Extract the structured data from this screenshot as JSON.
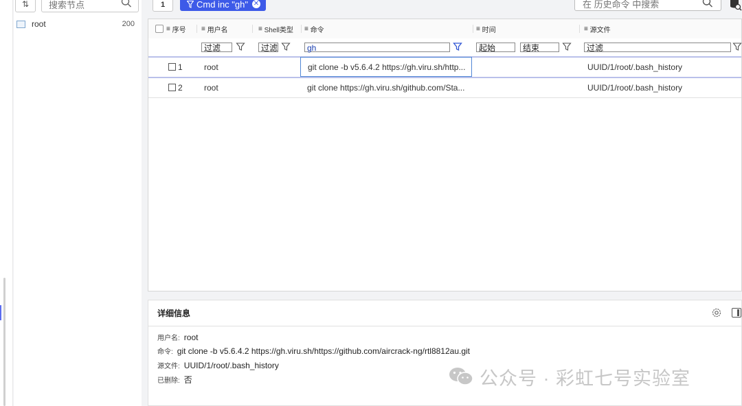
{
  "sidebar": {
    "sort_label": "⇅",
    "search_placeholder": "搜索节点",
    "tree": [
      {
        "label": "root",
        "count": "200"
      }
    ]
  },
  "toolbar": {
    "page_label": "1",
    "filter_chip": "Cmd inc \"gh\"",
    "history_search_placeholder": "在 历史命令 中搜索"
  },
  "table": {
    "headers": {
      "index": "序号",
      "username": "用户名",
      "shell_type": "Shell类型",
      "command": "命令",
      "time": "时间",
      "source_file": "源文件"
    },
    "filters": {
      "username": "过滤",
      "shell_type": "过滤",
      "command": "gh",
      "time_start": "起始",
      "time_end": "结束",
      "source_file": "过滤"
    },
    "rows": [
      {
        "index": "1",
        "username": "root",
        "shell_type": "",
        "command": "git clone -b v5.6.4.2 https://gh.viru.sh/http...",
        "time": "",
        "source_file": "UUID/1/root/.bash_history"
      },
      {
        "index": "2",
        "username": "root",
        "shell_type": "",
        "command": "git clone https://gh.viru.sh/github.com/Sta...",
        "time": "",
        "source_file": "UUID/1/root/.bash_history"
      }
    ]
  },
  "detail": {
    "title": "详细信息",
    "fields": [
      {
        "label": "用户名:",
        "value": "root"
      },
      {
        "label": "命令:",
        "value": "git clone -b v5.6.4.2 https://gh.viru.sh/https://github.com/aircrack-ng/rtl8812au.git"
      },
      {
        "label": "源文件:",
        "value": "UUID/1/root/.bash_history"
      },
      {
        "label": "已删除:",
        "value": "否"
      }
    ]
  },
  "watermark": "公众号 · 彩虹七号实验室",
  "colors": {
    "accent": "#3d5ae8",
    "selection_border": "#4f86d6",
    "row_divider": "#b9c0ea"
  }
}
